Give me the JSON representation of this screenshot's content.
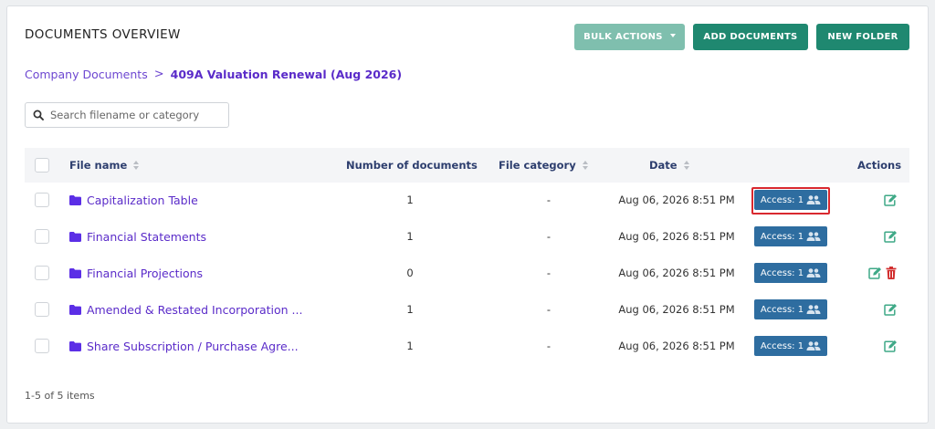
{
  "page": {
    "title": "DOCUMENTS OVERVIEW"
  },
  "toolbar": {
    "bulk_label": "BULK ACTIONS",
    "add_label": "ADD DOCUMENTS",
    "new_folder_label": "NEW FOLDER"
  },
  "breadcrumb": {
    "root": "Company Documents",
    "separator": ">",
    "current": "409A Valuation Renewal (Aug 2026)"
  },
  "search": {
    "placeholder": "Search filename or category",
    "value": ""
  },
  "table": {
    "headers": {
      "file_name": "File name",
      "num_docs": "Number of documents",
      "category": "File category",
      "date": "Date",
      "actions": "Actions"
    },
    "rows": [
      {
        "name": "Capitalization Table",
        "count": "1",
        "category": "-",
        "date": "Aug 06, 2026 8:51 PM",
        "access": "Access: 1",
        "can_delete": false,
        "highlighted": true
      },
      {
        "name": "Financial Statements",
        "count": "1",
        "category": "-",
        "date": "Aug 06, 2026 8:51 PM",
        "access": "Access: 1",
        "can_delete": false,
        "highlighted": false
      },
      {
        "name": "Financial Projections",
        "count": "0",
        "category": "-",
        "date": "Aug 06, 2026 8:51 PM",
        "access": "Access: 1",
        "can_delete": true,
        "highlighted": false
      },
      {
        "name": "Amended & Restated Incorporation ...",
        "count": "1",
        "category": "-",
        "date": "Aug 06, 2026 8:51 PM",
        "access": "Access: 1",
        "can_delete": false,
        "highlighted": false
      },
      {
        "name": "Share Subscription / Purchase Agre...",
        "count": "1",
        "category": "-",
        "date": "Aug 06, 2026 8:51 PM",
        "access": "Access: 1",
        "can_delete": false,
        "highlighted": false
      }
    ]
  },
  "footer": {
    "pagination": "1-5 of 5 items"
  },
  "icons": {
    "search": "search-icon",
    "folder": "folder-icon",
    "users": "users-icon",
    "edit": "edit-icon",
    "delete": "trash-icon",
    "sort": "sort-icon",
    "caret": "caret-down-icon"
  },
  "colors": {
    "primary_green": "#1f8870",
    "bulk_green": "#7fbfae",
    "link_purple": "#5a2bc9",
    "folder_purple": "#5b2ee6",
    "access_blue": "#2e6da0",
    "edit_green": "#3fa987",
    "delete_red": "#d22e2e",
    "highlight_red": "#d9282f"
  }
}
